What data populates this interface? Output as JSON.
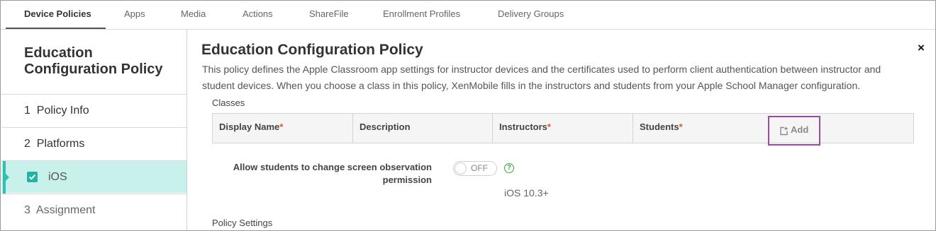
{
  "nav": {
    "tabs": [
      {
        "label": "Device Policies",
        "active": true
      },
      {
        "label": "Apps"
      },
      {
        "label": "Media"
      },
      {
        "label": "Actions"
      },
      {
        "label": "ShareFile"
      },
      {
        "label": "Enrollment Profiles"
      },
      {
        "label": "Delivery Groups"
      }
    ]
  },
  "sidebar": {
    "title": "Education Configuration Policy",
    "items": [
      {
        "label": "1  Policy Info"
      },
      {
        "label": "2  Platforms"
      },
      {
        "label": "iOS",
        "checked": true,
        "selected": true
      },
      {
        "label": "3  Assignment"
      }
    ]
  },
  "main": {
    "title": "Education Configuration Policy",
    "description": "This policy defines the Apple Classroom app settings for instructor devices and the certificates used to perform client authentication between instructor and student devices. When you choose a class in this policy, XenMobile fills in the instructors and students from your Apple School Manager configuration.",
    "classes_label": "Classes",
    "table": {
      "columns": [
        {
          "label": "Display Name",
          "required": "*"
        },
        {
          "label": "Description",
          "required": ""
        },
        {
          "label": "Instructors",
          "required": "*"
        },
        {
          "label": "Students",
          "required": "*"
        }
      ],
      "add_label": "Add"
    },
    "setting": {
      "label": "Allow students to change screen observation permission",
      "toggle_state": "OFF",
      "help": "?",
      "os_requirement": "iOS 10.3+"
    },
    "policy_settings_label": "Policy Settings",
    "close_label": "×"
  },
  "colors": {
    "accent": "#2ec0b2",
    "selected_bg": "#c9f1ec",
    "required": "#e2553b",
    "highlight_box": "#9a4aa0",
    "help": "#3aa24a"
  }
}
